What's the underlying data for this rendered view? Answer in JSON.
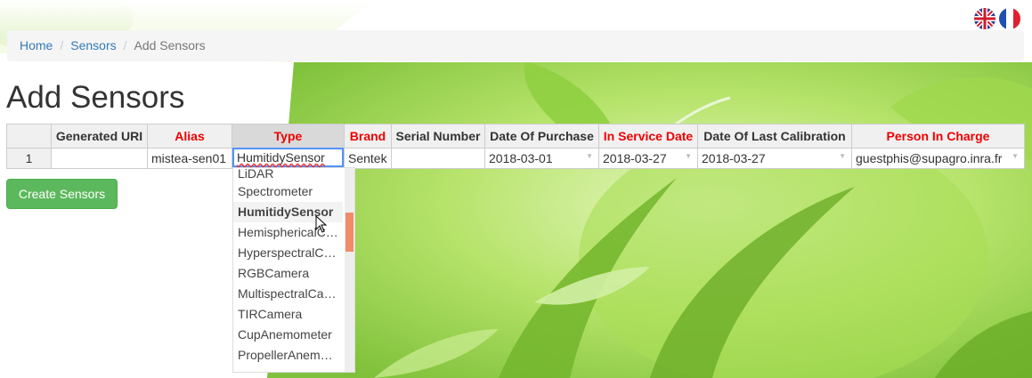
{
  "languages": [
    {
      "icon": "uk-flag-icon",
      "code": "en"
    },
    {
      "icon": "france-flag-icon",
      "code": "fr"
    }
  ],
  "breadcrumb": {
    "home": "Home",
    "sensors": "Sensors",
    "current": "Add Sensors",
    "separator": "/"
  },
  "page_title": "Add Sensors",
  "table": {
    "columns": [
      {
        "label": "",
        "required": false
      },
      {
        "label": "Generated URI",
        "required": false
      },
      {
        "label": "Alias",
        "required": true
      },
      {
        "label": "Type",
        "required": true
      },
      {
        "label": "Brand",
        "required": true
      },
      {
        "label": "Serial Number",
        "required": false
      },
      {
        "label": "Date Of Purchase",
        "required": false
      },
      {
        "label": "In Service Date",
        "required": true
      },
      {
        "label": "Date Of Last Calibration",
        "required": false
      },
      {
        "label": "Person In Charge",
        "required": true
      }
    ],
    "rows": [
      {
        "row_number": "1",
        "generated_uri": "",
        "alias": "mistea-sen01",
        "type": "HumitidySensor",
        "brand": "Sentek",
        "serial_number": "",
        "date_of_purchase": "2018-03-01",
        "in_service_date": "2018-03-27",
        "date_of_last_calibration": "2018-03-27",
        "person_in_charge": "guestphis@supagro.inra.fr"
      }
    ],
    "dropdown_arrow": "▼"
  },
  "type_editor": {
    "value": "HumitidySensor",
    "options": [
      "LiDAR",
      "Spectrometer",
      "HumitidySensor",
      "HemisphericalC…",
      "HyperspectralC…",
      "RGBCamera",
      "MultispectralCa…",
      "TIRCamera",
      "CupAnemometer",
      "PropellerAnem…"
    ],
    "selected_index": 2
  },
  "create_button": "Create Sensors",
  "colors": {
    "required_header": "#ee0000",
    "link": "#337ab7",
    "button": "#5cb85c",
    "editor_border": "#5292f7",
    "scroll_thumb": "#f08c68"
  }
}
